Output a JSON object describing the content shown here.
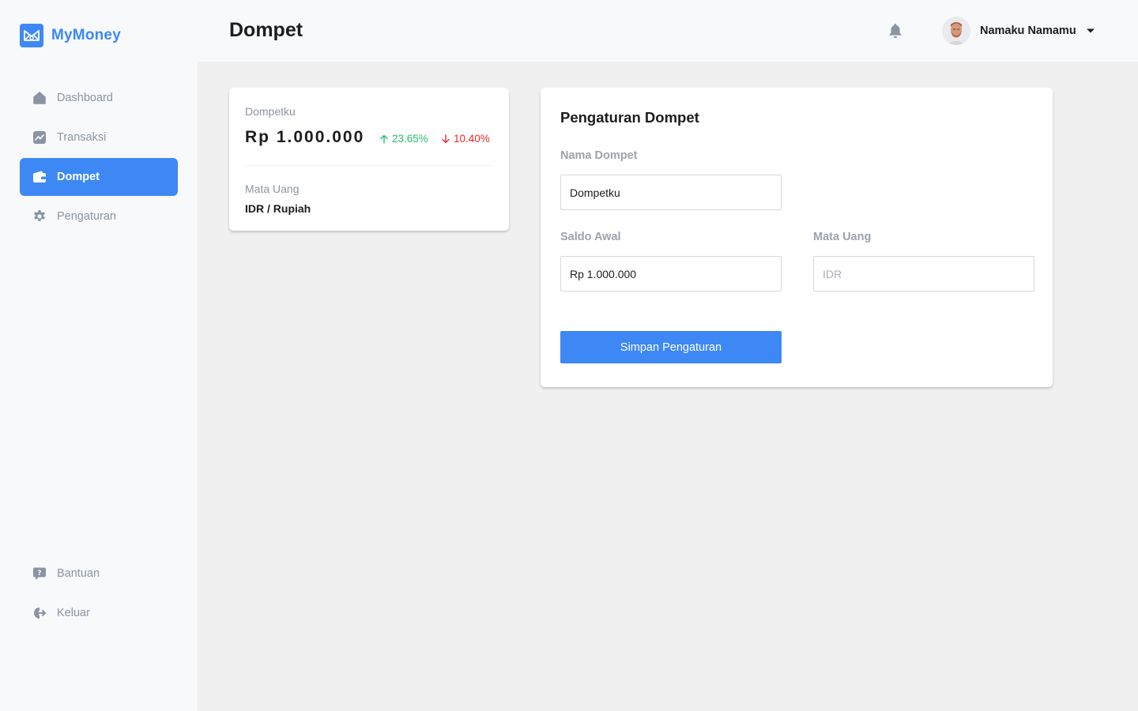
{
  "brand": {
    "name": "MyMoney",
    "accent": "#3d88f5"
  },
  "nav": {
    "top": [
      {
        "label": "Dashboard",
        "icon": "home-icon",
        "active": false
      },
      {
        "label": "Transaksi",
        "icon": "chart-line-icon",
        "active": false
      },
      {
        "label": "Dompet",
        "icon": "wallet-icon",
        "active": true
      },
      {
        "label": "Pengaturan",
        "icon": "gear-icon",
        "active": false
      }
    ],
    "bottom": [
      {
        "label": "Bantuan",
        "icon": "help-chat-icon"
      },
      {
        "label": "Keluar",
        "icon": "logout-icon"
      }
    ]
  },
  "header": {
    "title": "Dompet",
    "user_name": "Namaku Namamu"
  },
  "wallet": {
    "name": "Dompetku",
    "balance": "Rp 1.000.000",
    "change_up": "23.65%",
    "change_down": "10.40%",
    "currency_label": "Mata Uang",
    "currency_value": "IDR / Rupiah",
    "colors": {
      "up": "#21c067",
      "down": "#e52a2a"
    }
  },
  "settings": {
    "title": "Pengaturan Dompet",
    "name_label": "Nama Dompet",
    "name_value": "Dompetku",
    "balance_label": "Saldo Awal",
    "balance_value": "Rp 1.000.000",
    "currency_label": "Mata Uang",
    "currency_placeholder": "IDR",
    "save_label": "Simpan Pengaturan"
  }
}
